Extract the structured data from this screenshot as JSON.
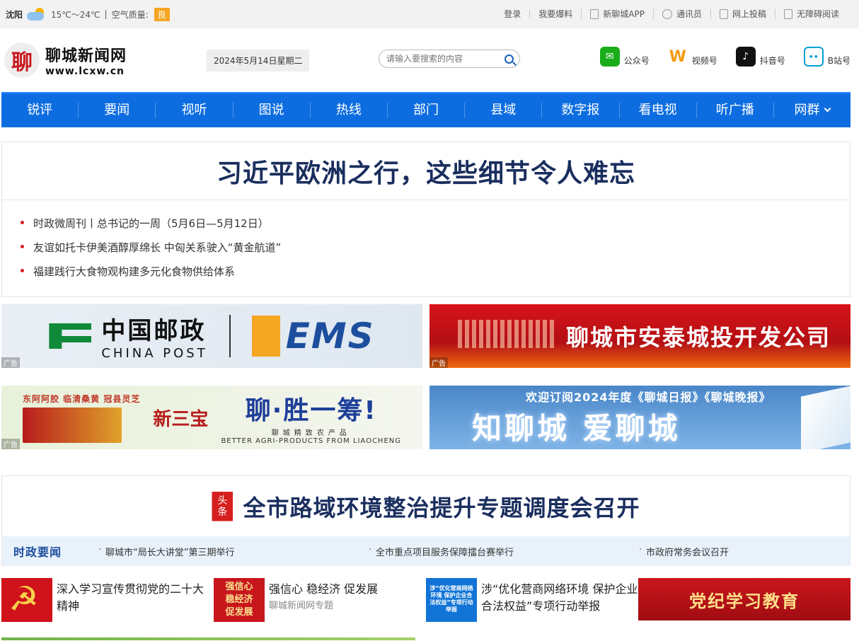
{
  "topbar": {
    "city": "沈阳",
    "temp": "15℃～24℃",
    "aq_label": "空气质量:",
    "aq_value": "良",
    "links": [
      "登录",
      "我要爆料",
      "新聊城APP",
      "通讯员",
      "网上投稿",
      "无障碍阅读"
    ]
  },
  "header": {
    "logo_mark": "聊",
    "logo_cn": "聊城新闻网",
    "logo_en": "www.lcxw.cn",
    "date": "2024年5月14日星期二",
    "search_placeholder": "请输入要搜索的内容",
    "socials": [
      {
        "icon": "wechat-icon",
        "label": "公众号"
      },
      {
        "icon": "video-channel-icon",
        "label": "视频号"
      },
      {
        "icon": "douyin-icon",
        "label": "抖音号"
      },
      {
        "icon": "bilibili-icon",
        "label": "B站号"
      }
    ]
  },
  "nav": [
    "锐评",
    "要闻",
    "视听",
    "图说",
    "热线",
    "部门",
    "县域",
    "数字报",
    "看电视",
    "听广播",
    "网群"
  ],
  "headline": {
    "title": "习近平欧洲之行，这些细节令人难忘",
    "items": [
      "时政微周刊丨总书记的一周（5月6日—5月12日）",
      "友谊如托卡伊美酒醇厚绵长 中匈关系驶入“黄金航道”",
      "福建践行大食物观构建多元化食物供给体系"
    ]
  },
  "ads": {
    "tag": "广告",
    "post_cn": "中国邮政",
    "post_en": "CHINA POST",
    "ems": "EMS",
    "antai": "聊城市安泰城投开发公司",
    "agri_brands": "东阿阿胶  临清桑黄  冠县灵芝",
    "agri_seal": "新三宝",
    "agri_slogan": "聊·胜一筹!",
    "agri_sub": "聊城精致农产品",
    "agri_en": "BETTER AGRI-PRODUCTS FROM LIAOCHENG",
    "paper_top": "欢迎订阅2024年度《聊城日报》《聊城晚报》",
    "paper_big": "知聊城 爱聊城"
  },
  "toutiao": {
    "badge_1": "头",
    "badge_2": "条",
    "title": "全市路域环境整治提升专题调度会召开",
    "szyw_label": "时政要闻",
    "news": [
      "聊城市“局长大讲堂”第三期举行",
      "全市重点项目服务保障擂台赛举行",
      "市政府常务会议召开"
    ]
  },
  "features": [
    {
      "title": "深入学习宣传贯彻党的二十大精神",
      "sub": ""
    },
    {
      "title": "强信心 稳经济 促发展",
      "sub": "聊城新闻网专题",
      "thumb_lines": [
        "强信心",
        "稳经济",
        "促发展"
      ]
    },
    {
      "title": "涉“优化营商网络环境 保护企业合法权益”专项行动举报",
      "sub": "",
      "thumb_text": "涉“优化营商网络环境 保护企业合法权益”专项行动举报"
    },
    {
      "title": "党纪学习教育",
      "sub": ""
    }
  ]
}
